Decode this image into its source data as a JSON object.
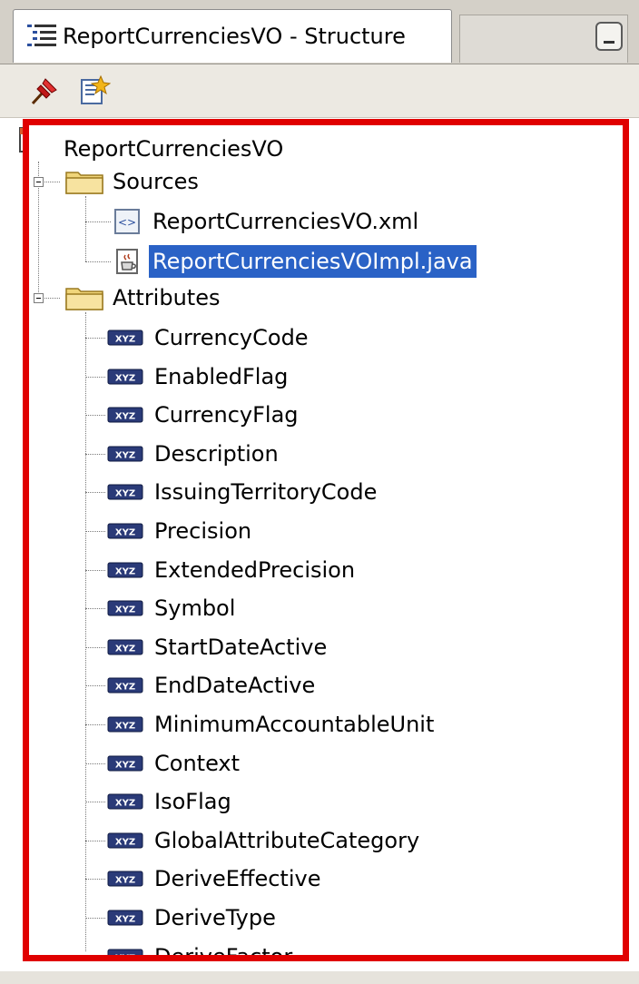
{
  "window": {
    "title": "ReportCurrenciesVO - Structure"
  },
  "toolbar": {
    "buttons": [
      {
        "icon": "pin-icon"
      },
      {
        "icon": "edit-document-icon"
      }
    ]
  },
  "tree": {
    "root": "ReportCurrenciesVO",
    "folders": [
      {
        "label": "Sources",
        "expanded": true,
        "items": [
          {
            "label": "ReportCurrenciesVO.xml",
            "icon": "xml-file-icon",
            "selected": false
          },
          {
            "label": "ReportCurrenciesVOImpl.java",
            "icon": "java-file-icon",
            "selected": true
          }
        ]
      },
      {
        "label": "Attributes",
        "expanded": true,
        "items": [
          {
            "label": "CurrencyCode"
          },
          {
            "label": "EnabledFlag"
          },
          {
            "label": "CurrencyFlag"
          },
          {
            "label": "Description"
          },
          {
            "label": "IssuingTerritoryCode"
          },
          {
            "label": "Precision"
          },
          {
            "label": "ExtendedPrecision"
          },
          {
            "label": "Symbol"
          },
          {
            "label": "StartDateActive"
          },
          {
            "label": "EndDateActive"
          },
          {
            "label": "MinimumAccountableUnit"
          },
          {
            "label": "Context"
          },
          {
            "label": "IsoFlag"
          },
          {
            "label": "GlobalAttributeCategory"
          },
          {
            "label": "DeriveEffective"
          },
          {
            "label": "DeriveType"
          },
          {
            "label": "DeriveFactor"
          }
        ]
      }
    ]
  },
  "colors": {
    "highlight_border": "#e00000",
    "selection": "#2a62c6"
  }
}
